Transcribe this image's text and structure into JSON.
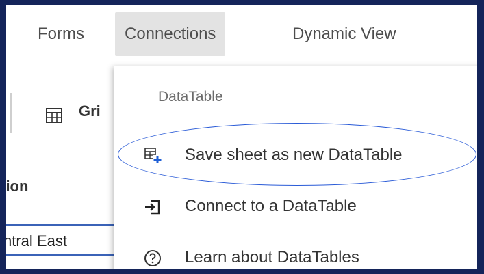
{
  "menubar": {
    "items": [
      {
        "label": "Forms"
      },
      {
        "label": "Connections"
      },
      {
        "label": "Dynamic View"
      }
    ]
  },
  "toolbar": {
    "grid_label": "Gri"
  },
  "grid": {
    "column_header": "gion",
    "cell_value": "ntral East"
  },
  "dropdown": {
    "section_title": "DataTable",
    "items": [
      {
        "label": "Save sheet as new DataTable",
        "icon": "add-table-icon"
      },
      {
        "label": "Connect to a DataTable",
        "icon": "connect-arrow-icon"
      },
      {
        "label": "Learn about DataTables",
        "icon": "help-circle-icon"
      }
    ]
  },
  "colors": {
    "background": "#14245a",
    "selected_menu": "#e3e3e3",
    "accent": "#2a5bd7"
  }
}
